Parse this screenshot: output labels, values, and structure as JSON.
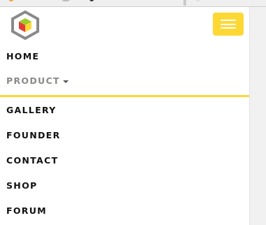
{
  "header": {
    "logo": "hexagon-cube-logo",
    "menu_toggle_icon": "hamburger-icon",
    "accent_color": "#fdd835"
  },
  "menu": {
    "items": [
      {
        "label": "HOME"
      },
      {
        "label": "PRODUCT",
        "icon": "caret-down-icon"
      },
      {
        "label": "GALLERY"
      },
      {
        "label": "FOUNDER"
      },
      {
        "label": "CONTACT"
      },
      {
        "label": "SHOP"
      },
      {
        "label": "FORUM"
      }
    ]
  }
}
